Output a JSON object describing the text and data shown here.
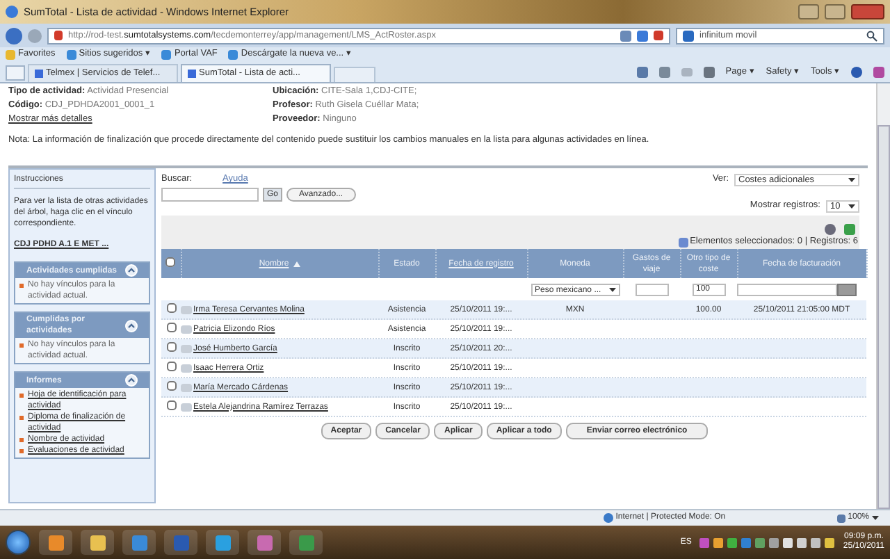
{
  "window": {
    "title": "SumTotal - Lista de actividad - Windows Internet Explorer"
  },
  "address": {
    "url_prefix": "http://rod-test.",
    "url_domain": "sumtotalsystems.com",
    "url_path": "/tecdemonterrey/app/management/LMS_ActRoster.aspx"
  },
  "search_box": {
    "value": "infinitum movil"
  },
  "favorites_bar": {
    "favorites": "Favorites",
    "items": [
      {
        "label": "Sitios sugeridos ▾"
      },
      {
        "label": "Portal VAF"
      },
      {
        "label": "Descárgate la nueva ve... ▾"
      }
    ]
  },
  "tabs": [
    {
      "label": "Telmex | Servicios de Telef...",
      "selected": false
    },
    {
      "label": "SumTotal - Lista de acti...",
      "selected": true
    }
  ],
  "command_bar": [
    "Page ▾",
    "Safety ▾",
    "Tools ▾"
  ],
  "details": [
    {
      "label": "Tipo de actividad:",
      "value": "Actividad Presencial"
    },
    {
      "label": "Ubicación:",
      "value": "CITE-Sala 1,CDJ-CITE;"
    },
    {
      "label": "Código:",
      "value": "CDJ_PDHDA2001_0001_1"
    },
    {
      "label": "Profesor:",
      "value": "Ruth Gisela Cuéllar Mata;"
    },
    {
      "kind": "link",
      "label": "Mostrar más detalles"
    },
    {
      "label": "Proveedor:",
      "value": "Ninguno"
    }
  ],
  "note": "Nota: La información de finalización que procede directamente del contenido puede sustituir los cambios manuales en la lista para algunas actividades en línea.",
  "sidebar": {
    "title": "Instrucciones",
    "text": "Para ver la lista de otras actividades del árbol, haga clic en el vínculo correspondiente.",
    "link": "CDJ PDHD A.1 E MET ...",
    "panels": [
      {
        "title": "Actividades cumplidas",
        "expanded": true,
        "items": [
          {
            "kind": "text",
            "label": "No hay vínculos para la actividad actual."
          }
        ]
      },
      {
        "title": "Cumplidas por actividades",
        "expanded": true,
        "items": [
          {
            "kind": "text",
            "label": "No hay vínculos para la actividad actual."
          }
        ]
      },
      {
        "title": "Informes",
        "expanded": true,
        "items": [
          {
            "kind": "link",
            "label": "Hoja de identificación para actividad"
          },
          {
            "kind": "link",
            "label": "Diploma de finalización de actividad"
          },
          {
            "kind": "link",
            "label": "Nombre de actividad"
          },
          {
            "kind": "link",
            "label": "Evaluaciones de actividad"
          }
        ]
      }
    ]
  },
  "search": {
    "label": "Buscar:",
    "help": "Ayuda",
    "go": "Go",
    "advanced": "Avanzado..."
  },
  "view": {
    "label": "Ver:",
    "value": "Costes adicionales"
  },
  "records": {
    "label": "Mostrar registros:",
    "value": "10"
  },
  "selection": "Elementos seleccionados: 0 | Registros: 6",
  "table": {
    "select_all_checked": false,
    "columns": [
      {
        "label": "Nombre",
        "link": true
      },
      {
        "label": "Estado",
        "link": false
      },
      {
        "label": "Fecha de registro",
        "link": true
      },
      {
        "label": "Moneda",
        "link": false
      },
      {
        "label": "Gastos de viaje",
        "link": false
      },
      {
        "label": "Otro tipo de coste",
        "link": false
      },
      {
        "label": "Fecha de facturación",
        "link": false
      }
    ],
    "filter": {
      "currency": "Peso mexicano ...",
      "other": "100"
    },
    "rows": [
      {
        "checked": false,
        "name": "Irma Teresa Cervantes Molina",
        "status": "Asistencia",
        "date": "25/10/2011 19:...",
        "currency": "MXN",
        "other": "100.00",
        "billing": "25/10/2011 21:05:00 MDT"
      },
      {
        "checked": false,
        "name": "Patricia Elizondo Ríos",
        "status": "Asistencia",
        "date": "25/10/2011 19:..."
      },
      {
        "checked": false,
        "name": "José Humberto García",
        "status": "Inscrito",
        "date": "25/10/2011 20:..."
      },
      {
        "checked": false,
        "name": "Isaac Herrera Ortiz",
        "status": "Inscrito",
        "date": "25/10/2011 19:..."
      },
      {
        "checked": false,
        "name": "María Mercado Cárdenas",
        "status": "Inscrito",
        "date": "25/10/2011 19:..."
      },
      {
        "checked": false,
        "name": "Estela Alejandrina Ramírez Terrazas",
        "status": "Inscrito",
        "date": "25/10/2011 19:..."
      }
    ]
  },
  "buttons": [
    "Aceptar",
    "Cancelar",
    "Aplicar",
    "Aplicar a todo",
    "Enviar correo electrónico"
  ],
  "status_bar": {
    "zone": "Internet | Protected Mode: On",
    "zoom": "100%"
  },
  "taskbar": {
    "language": "ES",
    "time": "09:09 p.m.",
    "date": "25/10/2011"
  }
}
